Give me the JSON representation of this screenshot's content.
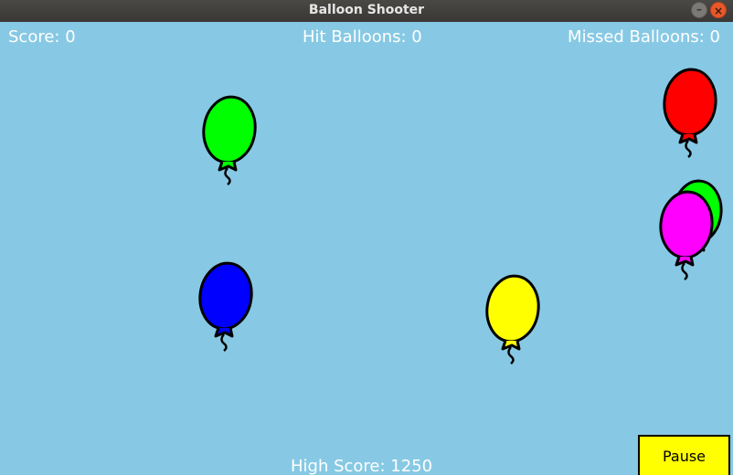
{
  "window": {
    "title": "Balloon Shooter"
  },
  "hud": {
    "score_label": "Score: 0",
    "hit_label": "Hit Balloons: 0",
    "missed_label": "Missed Balloons: 0",
    "high_score_label": "High Score: 1250"
  },
  "controls": {
    "pause_label": "Pause"
  },
  "colors": {
    "sky": "#87c9e4",
    "pause_button": "#ffff00"
  },
  "balloons": [
    {
      "color": "#00ff00",
      "name": "green"
    },
    {
      "color": "#ff0000",
      "name": "red"
    },
    {
      "color": "#00ff00",
      "name": "green"
    },
    {
      "color": "#ff00ff",
      "name": "magenta"
    },
    {
      "color": "#0000ff",
      "name": "blue"
    },
    {
      "color": "#ffff00",
      "name": "yellow"
    }
  ]
}
